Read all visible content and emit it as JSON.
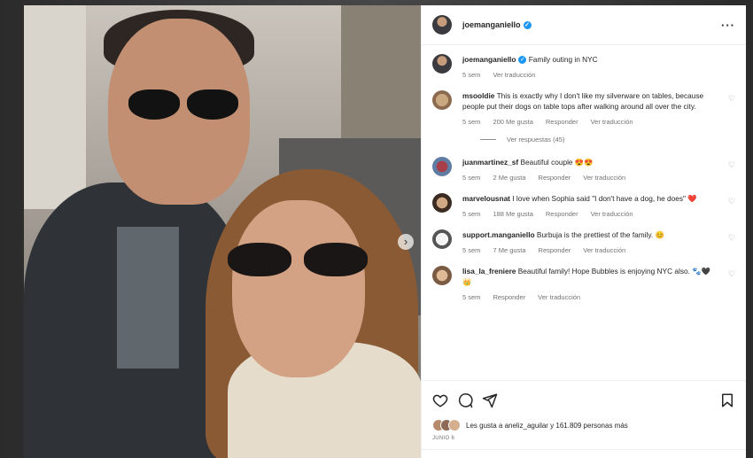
{
  "post": {
    "author": "joemanganiello",
    "verified": true,
    "caption": "Family outing in NYC",
    "caption_age": "5 sem",
    "see_translation": "Ver traducción"
  },
  "comments": [
    {
      "user": "msooldie",
      "text": "This is exactly why I don't like my silverware on tables, because people put their dogs on table tops after walking around all over the city.",
      "age": "5 sem",
      "likes": "200 Me gusta",
      "reply": "Responder",
      "translate": "Ver traducción",
      "replies_label": "Ver respuestas (45)"
    },
    {
      "user": "juanmartinez_sf",
      "text": "Beautiful couple 😍😍",
      "age": "5 sem",
      "likes": "2 Me gusta",
      "reply": "Responder",
      "translate": "Ver traducción"
    },
    {
      "user": "marvelousnat",
      "text": "I love when Sophia said \"I don't have a dog, he does\" ❤️",
      "age": "5 sem",
      "likes": "188 Me gusta",
      "reply": "Responder",
      "translate": "Ver traducción"
    },
    {
      "user": "support.manganiello",
      "text": "Burbuja is the prettiest of the family. 😊",
      "age": "5 sem",
      "likes": "7 Me gusta",
      "reply": "Responder",
      "translate": "Ver traducción"
    },
    {
      "user": "lisa_la_freniere",
      "text": "Beautiful family! Hope Bubbles is enjoying NYC also. 🐾🖤👑",
      "age": "5 sem",
      "likes": "",
      "reply": "Responder",
      "translate": "Ver traducción"
    }
  ],
  "likes_summary": "Les gusta a aneliz_aguilar y 161.809 personas más",
  "date": "JUNIO 6",
  "icons": {
    "like": "heart-icon",
    "comment": "comment-icon",
    "share": "share-icon",
    "save": "bookmark-icon",
    "more": "more-options-icon",
    "next": "carousel-next-icon"
  },
  "colors": {
    "verified": "#1c96f0",
    "text": "#262626",
    "muted": "#737373"
  }
}
